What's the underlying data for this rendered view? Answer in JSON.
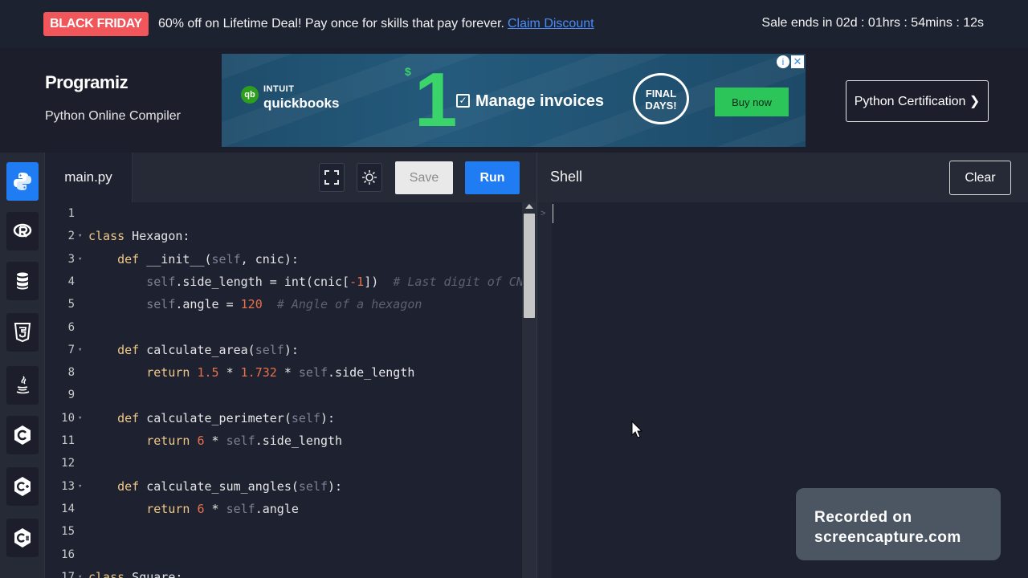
{
  "promo": {
    "badge": "BLACK FRIDAY",
    "text": "60% off on Lifetime Deal! Pay once for skills that pay forever.",
    "link": "Claim Discount",
    "timer": "Sale ends in 02d : 01hrs : 54mins : 12s"
  },
  "header": {
    "logo": "Programiz",
    "subtitle": "Python Online Compiler",
    "cert_button": "Python Certification ❯"
  },
  "ad": {
    "brand_top": "INTUIT",
    "brand_bottom": "quickbooks",
    "big_number": "1",
    "dollar": "$",
    "headline": "Manage invoices",
    "final_line1": "FINAL",
    "final_line2": "DAYS!",
    "buy_button": "Buy now",
    "info": "i",
    "close": "✕"
  },
  "languages": [
    {
      "name": "python",
      "icon": "python-icon",
      "active": true
    },
    {
      "name": "r",
      "icon": "r-icon",
      "active": false
    },
    {
      "name": "sql",
      "icon": "database-icon",
      "active": false
    },
    {
      "name": "html",
      "icon": "html5-icon",
      "active": false
    },
    {
      "name": "java",
      "icon": "java-icon",
      "active": false
    },
    {
      "name": "c",
      "icon": "c-icon",
      "active": false
    },
    {
      "name": "cpp",
      "icon": "cpp-icon",
      "active": false
    },
    {
      "name": "csharp",
      "icon": "csharp-icon",
      "active": false
    }
  ],
  "editor": {
    "filename": "main.py",
    "save_label": "Save",
    "run_label": "Run",
    "lines": [
      {
        "n": "1",
        "fold": false,
        "tokens": []
      },
      {
        "n": "2",
        "fold": true,
        "tokens": [
          [
            "kw",
            "class"
          ],
          [
            "t",
            " Hexagon:"
          ]
        ]
      },
      {
        "n": "3",
        "fold": true,
        "tokens": [
          [
            "t",
            "    "
          ],
          [
            "kw",
            "def"
          ],
          [
            "t",
            " __init__("
          ],
          [
            "sf",
            "self"
          ],
          [
            "t",
            ", cnic):"
          ]
        ]
      },
      {
        "n": "4",
        "fold": false,
        "tokens": [
          [
            "t",
            "        "
          ],
          [
            "sf",
            "self"
          ],
          [
            "t",
            ".side_length = int(cnic["
          ],
          [
            "num",
            "-1"
          ],
          [
            "t",
            "])  "
          ],
          [
            "cm",
            "# Last digit of CNIC"
          ]
        ]
      },
      {
        "n": "5",
        "fold": false,
        "tokens": [
          [
            "t",
            "        "
          ],
          [
            "sf",
            "self"
          ],
          [
            "t",
            ".angle = "
          ],
          [
            "num",
            "120"
          ],
          [
            "t",
            "  "
          ],
          [
            "cm",
            "# Angle of a hexagon"
          ]
        ]
      },
      {
        "n": "6",
        "fold": false,
        "tokens": []
      },
      {
        "n": "7",
        "fold": true,
        "tokens": [
          [
            "t",
            "    "
          ],
          [
            "kw",
            "def"
          ],
          [
            "t",
            " calculate_area("
          ],
          [
            "sf",
            "self"
          ],
          [
            "t",
            "):"
          ]
        ]
      },
      {
        "n": "8",
        "fold": false,
        "tokens": [
          [
            "t",
            "        "
          ],
          [
            "kw",
            "return"
          ],
          [
            "t",
            " "
          ],
          [
            "num",
            "1.5"
          ],
          [
            "t",
            " * "
          ],
          [
            "num",
            "1.732"
          ],
          [
            "t",
            " * "
          ],
          [
            "sf",
            "self"
          ],
          [
            "t",
            ".side_length"
          ]
        ]
      },
      {
        "n": "9",
        "fold": false,
        "tokens": []
      },
      {
        "n": "10",
        "fold": true,
        "tokens": [
          [
            "t",
            "    "
          ],
          [
            "kw",
            "def"
          ],
          [
            "t",
            " calculate_perimeter("
          ],
          [
            "sf",
            "self"
          ],
          [
            "t",
            "):"
          ]
        ]
      },
      {
        "n": "11",
        "fold": false,
        "tokens": [
          [
            "t",
            "        "
          ],
          [
            "kw",
            "return"
          ],
          [
            "t",
            " "
          ],
          [
            "num",
            "6"
          ],
          [
            "t",
            " * "
          ],
          [
            "sf",
            "self"
          ],
          [
            "t",
            ".side_length"
          ]
        ]
      },
      {
        "n": "12",
        "fold": false,
        "tokens": []
      },
      {
        "n": "13",
        "fold": true,
        "tokens": [
          [
            "t",
            "    "
          ],
          [
            "kw",
            "def"
          ],
          [
            "t",
            " calculate_sum_angles("
          ],
          [
            "sf",
            "self"
          ],
          [
            "t",
            "):"
          ]
        ]
      },
      {
        "n": "14",
        "fold": false,
        "tokens": [
          [
            "t",
            "        "
          ],
          [
            "kw",
            "return"
          ],
          [
            "t",
            " "
          ],
          [
            "num",
            "6"
          ],
          [
            "t",
            " * "
          ],
          [
            "sf",
            "self"
          ],
          [
            "t",
            ".angle"
          ]
        ]
      },
      {
        "n": "15",
        "fold": false,
        "tokens": []
      },
      {
        "n": "16",
        "fold": false,
        "tokens": []
      },
      {
        "n": "17",
        "fold": true,
        "tokens": [
          [
            "kw",
            "class"
          ],
          [
            "t",
            " Square:"
          ]
        ]
      }
    ]
  },
  "shell": {
    "title": "Shell",
    "clear_label": "Clear",
    "prompt": ">"
  },
  "watermark": {
    "line1": "Recorded on",
    "line2": "screencapture.com"
  },
  "colors": {
    "accent": "#1f7cf2",
    "promo_badge": "#f0565a",
    "ad_green": "#2cc55a"
  }
}
